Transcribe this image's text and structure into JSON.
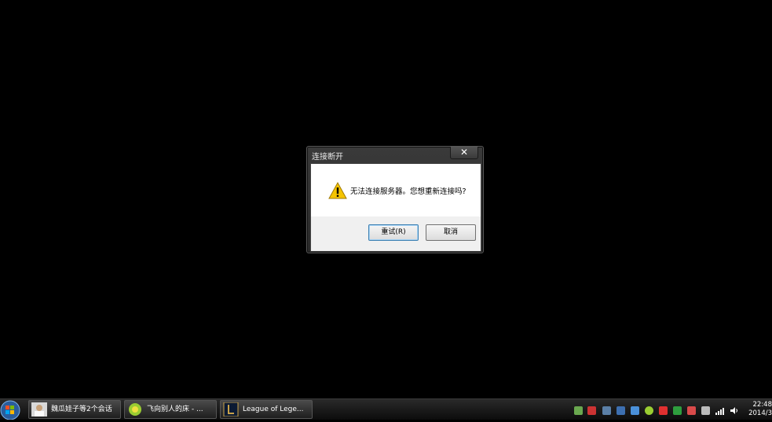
{
  "dialog": {
    "title": "连接断开",
    "close_symbol": "✕",
    "message": "无法连接服务器。您想重新连接吗?",
    "retry_label": "重试(R)",
    "cancel_label": "取消",
    "icon": "warning-icon"
  },
  "taskbar": {
    "tasks": [
      {
        "label": "魏瓜娃子等2个会话",
        "icon": "avatar-icon"
      },
      {
        "label": "飞向别人的床 - ...",
        "icon": "music-player-icon"
      },
      {
        "label": "League of Lege...",
        "icon": "league-of-legends-icon"
      }
    ],
    "clock_time": "22:48",
    "clock_date": "2014/3"
  },
  "colors": {
    "accent_blue": "#3c7fb1",
    "warning_yellow": "#f5c400"
  }
}
